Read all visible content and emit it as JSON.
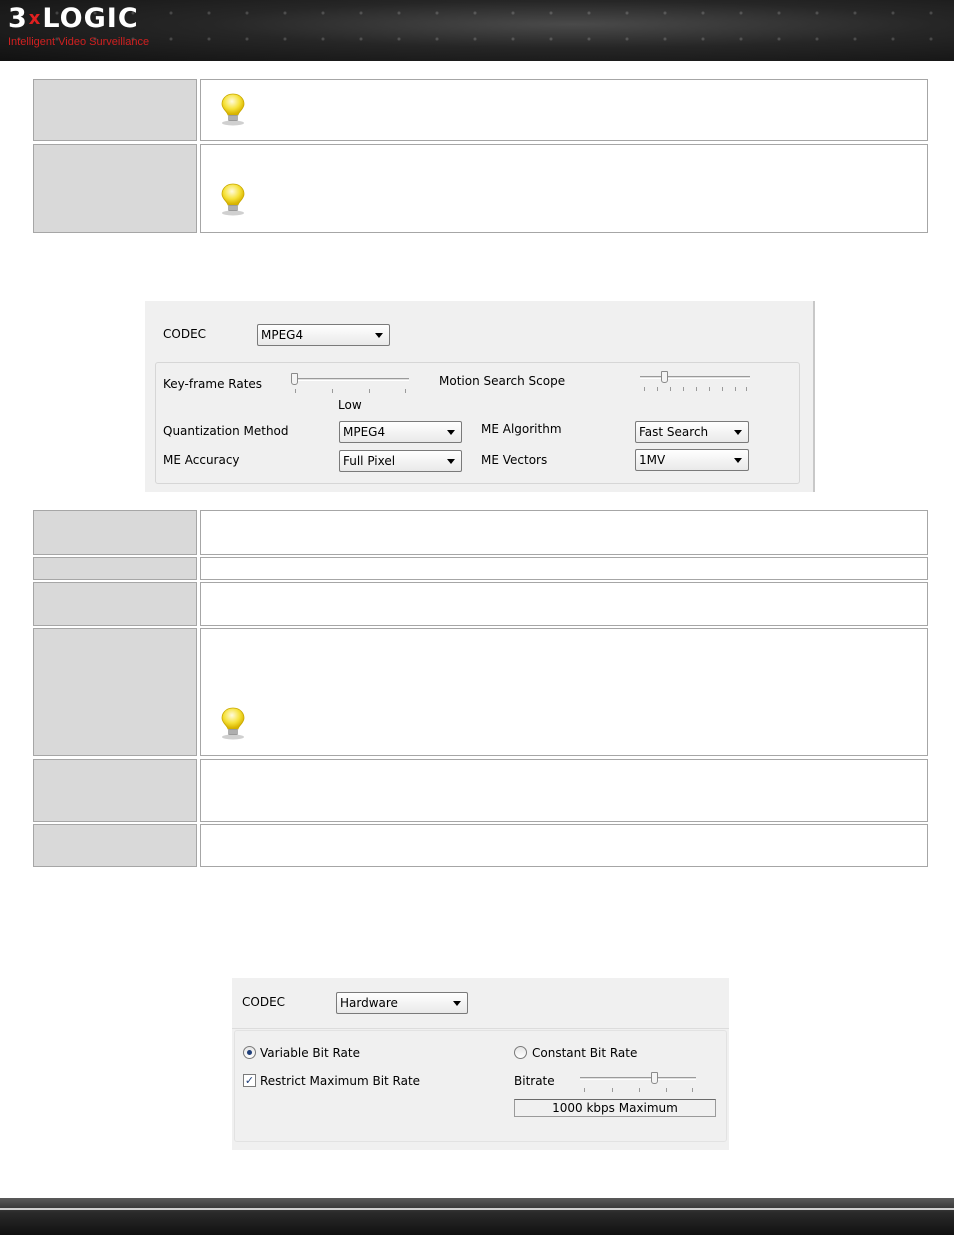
{
  "header": {
    "logo_main_left": "3",
    "logo_x": "x",
    "logo_main_right": "LOGIC",
    "logo_tagline": "Intelligent Video Surveillance"
  },
  "icons": {
    "tip": "lightbulb-icon"
  },
  "dialog1": {
    "codec_label": "CODEC",
    "codec_value": "MPEG4",
    "keyframe_label": "Key-frame Rates",
    "keyframe_value_label": "Low",
    "keyframe_level": 0,
    "motion_scope_label": "Motion Search Scope",
    "motion_scope_level": 0.2,
    "quant_label": "Quantization Method",
    "quant_value": "MPEG4",
    "me_algorithm_label": "ME Algorithm",
    "me_algorithm_value": "Fast Search",
    "me_accuracy_label": "ME Accuracy",
    "me_accuracy_value": "Full Pixel",
    "me_vectors_label": "ME Vectors",
    "me_vectors_value": "1MV"
  },
  "dialog2": {
    "codec_label": "CODEC",
    "codec_value": "Hardware",
    "vbr_label": "Variable Bit Rate",
    "vbr_selected": true,
    "cbr_label": "Constant Bit Rate",
    "cbr_selected": false,
    "restrict_label": "Restrict Maximum Bit Rate",
    "restrict_checked": true,
    "checkmark": "✓",
    "bitrate_label": "Bitrate",
    "bitrate_level": 0.65,
    "bitrate_readout": "1000 kbps Maximum"
  },
  "colors": {
    "table_label_bg": "#d9d9d9",
    "table_border": "#a6a6a6",
    "dialog_bg": "#f0f0f0",
    "logo_accent": "#e02020"
  }
}
